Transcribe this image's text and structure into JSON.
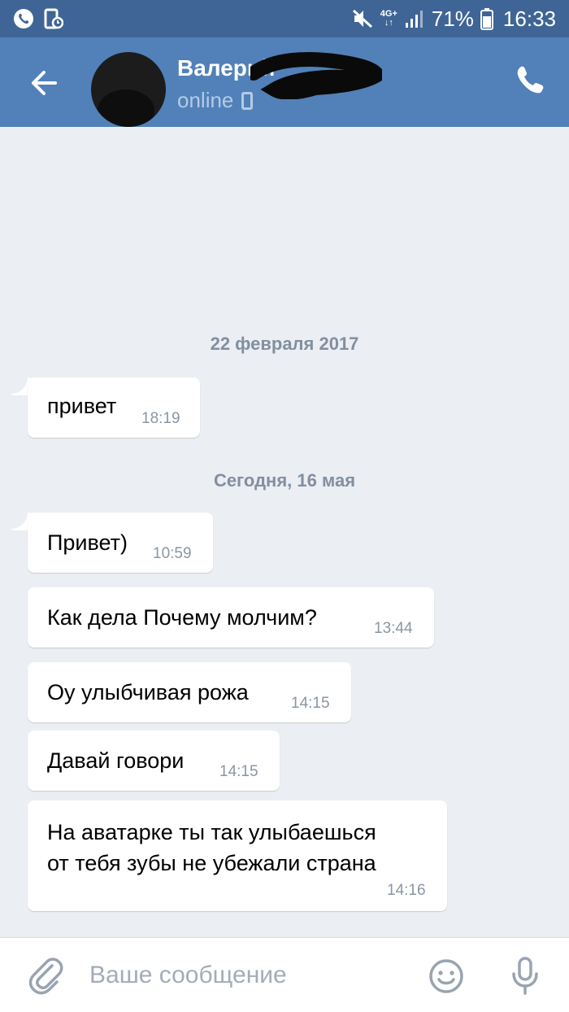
{
  "status_bar": {
    "network_top": "4G+",
    "battery_percent": "71%",
    "time": "16:33"
  },
  "header": {
    "contact_name": "Валерий",
    "contact_status": "online"
  },
  "chat": {
    "date_separators": [
      "22 февраля 2017",
      "Сегодня, 16 мая"
    ],
    "messages": [
      {
        "text": "привет",
        "time": "18:19"
      },
      {
        "text": "Привет)",
        "time": "10:59"
      },
      {
        "text": "Как дела Почему молчим?",
        "time": "13:44"
      },
      {
        "text": "Оу улыбчивая рожа",
        "time": "14:15"
      },
      {
        "text": "Давай говори",
        "time": "14:15"
      },
      {
        "text_line1": "На аватарке ты так улыбаешься",
        "text_line2": "от тебя зубы не убежали страна",
        "time": "14:16"
      }
    ]
  },
  "composer": {
    "placeholder": "Ваше сообщение"
  },
  "icons": {
    "back": "arrow-left-icon",
    "call": "phone-icon",
    "attach": "paperclip-icon",
    "emoji": "smiley-icon",
    "mic": "microphone-icon"
  },
  "colors": {
    "header": "#5181b8",
    "status_bar": "#3f6596",
    "chat_bg": "#ebeef3",
    "bubble": "#ffffff"
  }
}
